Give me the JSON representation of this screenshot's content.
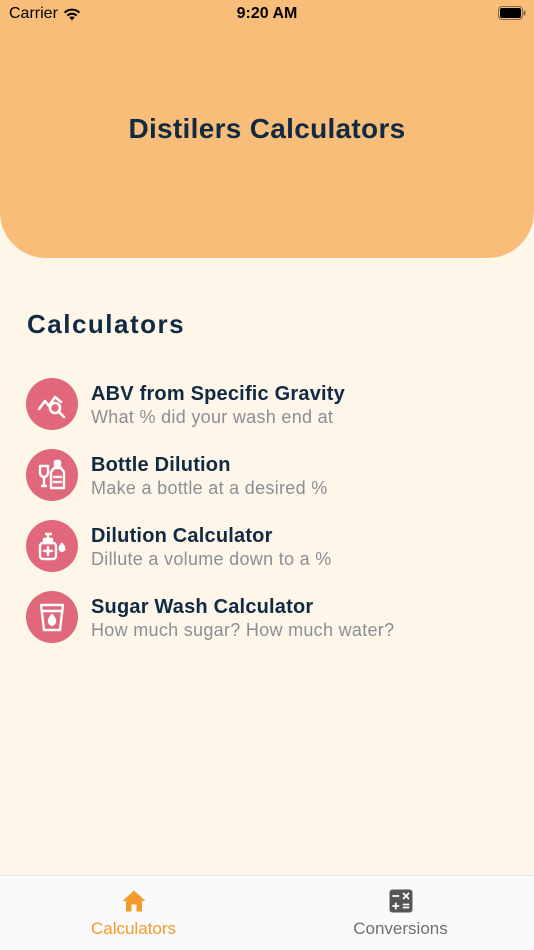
{
  "status_bar": {
    "carrier": "Carrier",
    "time": "9:20 AM"
  },
  "header": {
    "title": "Distilers Calculators"
  },
  "section": {
    "title": "Calculators"
  },
  "items": [
    {
      "title": "ABV from Specific Gravity",
      "subtitle": "What % did your wash end at",
      "icon": "chart-search-icon"
    },
    {
      "title": "Bottle Dilution",
      "subtitle": "Make a bottle at a desired %",
      "icon": "bottle-glass-icon"
    },
    {
      "title": "Dilution Calculator",
      "subtitle": "Dillute a volume down to a %",
      "icon": "sanitizer-drop-icon"
    },
    {
      "title": "Sugar Wash Calculator",
      "subtitle": "How much sugar? How much water?",
      "icon": "glass-drop-icon"
    }
  ],
  "tabbar": {
    "tabs": [
      {
        "label": "Calculators",
        "icon": "home-icon",
        "active": true
      },
      {
        "label": "Conversions",
        "icon": "calculator-icon",
        "active": false
      }
    ]
  },
  "colors": {
    "header": "#f9bd7a",
    "background": "#fef6e9",
    "icon_bg": "#e0687a",
    "active_tab": "#f29b2a",
    "text": "#102a43"
  }
}
